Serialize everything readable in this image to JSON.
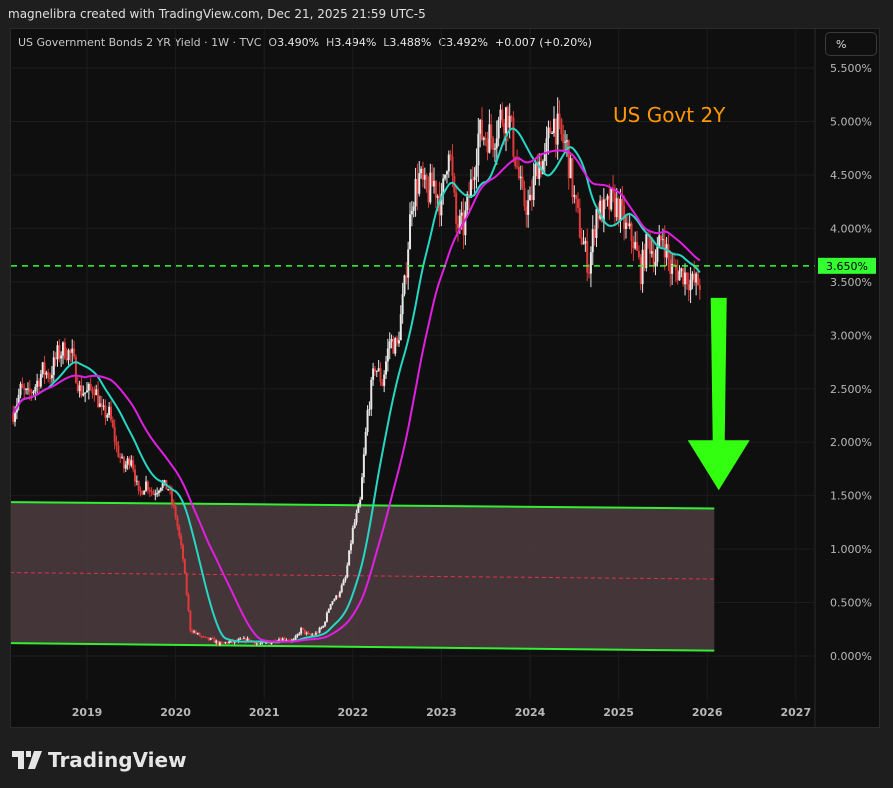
{
  "header": "magnelibra created with TradingView.com, Dec 21, 2025 21:59 UTC-5",
  "legend": {
    "symbol": "US Government Bonds 2 YR Yield · 1W · TVC",
    "o_label": "O",
    "o": "3.490%",
    "h_label": "H",
    "h": "3.494%",
    "l_label": "L",
    "l": "3.488%",
    "c_label": "C",
    "c": "3.492%",
    "change": "+0.007 (+0.20%)"
  },
  "scale_button": "%",
  "brand": "TradingView",
  "chart_data": {
    "type": "candlestick",
    "title": "US Govt 2Y",
    "ylim": [
      -0.45,
      6.0
    ],
    "xlim": [
      2018.13,
      2027.2
    ],
    "y_ticks": [
      "5.500%",
      "5.000%",
      "4.500%",
      "4.000%",
      "3.500%",
      "3.000%",
      "2.500%",
      "2.000%",
      "1.500%",
      "1.000%",
      "0.500%",
      "0.000%"
    ],
    "y_tick_values": [
      5.5,
      5.0,
      4.5,
      4.0,
      3.5,
      3.0,
      2.5,
      2.0,
      1.5,
      1.0,
      0.5,
      0.0
    ],
    "x_ticks": [
      "2019",
      "2020",
      "2021",
      "2022",
      "2023",
      "2024",
      "2025",
      "2026",
      "2027"
    ],
    "x_tick_values": [
      2019,
      2020,
      2021,
      2022,
      2023,
      2024,
      2025,
      2026,
      2027
    ],
    "start": "2018-03",
    "monthly_close": [
      2.27,
      2.49,
      2.43,
      2.53,
      2.67,
      2.63,
      2.82,
      2.87,
      2.8,
      2.49,
      2.46,
      2.52,
      2.27,
      2.27,
      1.95,
      1.76,
      1.87,
      1.5,
      1.62,
      1.52,
      1.61,
      1.57,
      1.31,
      0.91,
      0.25,
      0.2,
      0.16,
      0.15,
      0.11,
      0.13,
      0.13,
      0.15,
      0.15,
      0.12,
      0.11,
      0.13,
      0.16,
      0.16,
      0.14,
      0.25,
      0.19,
      0.21,
      0.28,
      0.5,
      0.57,
      0.73,
      1.18,
      1.44,
      2.28,
      2.72,
      2.56,
      2.95,
      2.89,
      3.45,
      4.28,
      4.48,
      4.31,
      4.43,
      4.21,
      4.82,
      4.03,
      4.01,
      4.4,
      4.87,
      4.88,
      4.86,
      5.04,
      5.09,
      4.68,
      4.25,
      4.21,
      4.62,
      4.62,
      5.04,
      4.87,
      4.75,
      4.26,
      3.91,
      3.64,
      4.17,
      4.15,
      4.24,
      4.2,
      3.99,
      3.89,
      3.6,
      3.9,
      3.72,
      3.94,
      3.62,
      3.6,
      3.57,
      3.49,
      3.49
    ],
    "moving_averages": [
      {
        "color": "#26d7c4",
        "period_months": 5
      },
      {
        "color": "#e020e0",
        "period_months": 10
      }
    ],
    "horizontal_level": {
      "value": 3.65,
      "label": "3.650%",
      "color": "#33ff33"
    },
    "channel": {
      "upper": [
        [
          2018.13,
          1.44
        ],
        [
          2026.08,
          1.38
        ]
      ],
      "lower": [
        [
          2018.13,
          0.12
        ],
        [
          2026.08,
          0.05
        ]
      ],
      "mid": [
        [
          2018.13,
          0.78
        ],
        [
          2026.08,
          0.72
        ]
      ],
      "fill": "#4a3a3e",
      "line_color": "#33ee33",
      "mid_color": "#e03050"
    },
    "arrow": {
      "x": 2026.13,
      "from": 3.35,
      "to": 1.55,
      "color": "#33ff11"
    },
    "colors": {
      "up": "#e8e8e8",
      "down": "#e03a3a",
      "title": "#ff9800"
    }
  }
}
